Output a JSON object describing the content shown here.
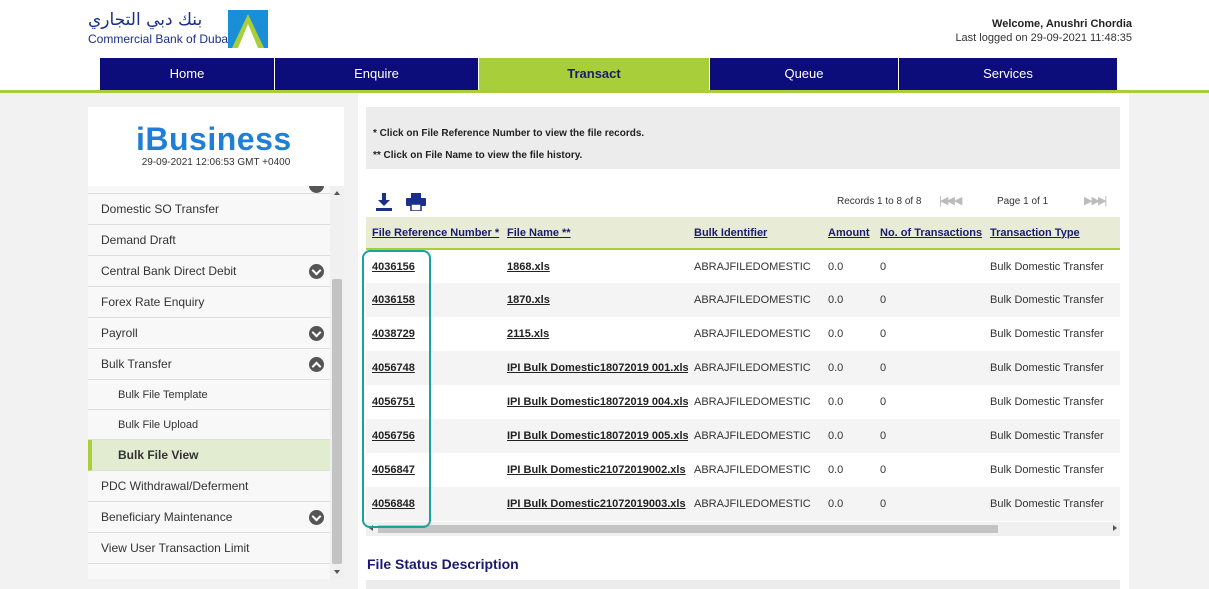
{
  "header": {
    "bank_name_arabic": "بنك دبي التجاري",
    "bank_name_english": "Commercial Bank of Dubai",
    "welcome": "Welcome, Anushri Chordia",
    "last_logged": "Last logged on 29-09-2021 11:48:35",
    "brand_color": "#1a2f8a"
  },
  "nav": {
    "items": [
      {
        "label": "Home",
        "active": false
      },
      {
        "label": "Enquire",
        "active": false
      },
      {
        "label": "Transact",
        "active": true
      },
      {
        "label": "Queue",
        "active": false
      },
      {
        "label": "Services",
        "active": false
      }
    ],
    "accent_color": "#a8cf3a",
    "nav_color": "#0c0c7a"
  },
  "sidebar": {
    "brand": "iBusiness",
    "timestamp": "29-09-2021 12:06:53 GMT +0400",
    "items": [
      {
        "label": "Domestic SO Transfer",
        "expander": ""
      },
      {
        "label": "Demand Draft",
        "expander": ""
      },
      {
        "label": "Central Bank Direct Debit",
        "expander": "down"
      },
      {
        "label": "Forex Rate Enquiry",
        "expander": ""
      },
      {
        "label": "Payroll",
        "expander": "down"
      },
      {
        "label": "Bulk Transfer",
        "expander": "up"
      },
      {
        "label": "Bulk File Template",
        "sub": true
      },
      {
        "label": "Bulk File Upload",
        "sub": true
      },
      {
        "label": "Bulk File View",
        "sub": true,
        "selected": true
      },
      {
        "label": "PDC Withdrawal/Deferment",
        "expander": ""
      },
      {
        "label": "Beneficiary Maintenance",
        "expander": "down"
      },
      {
        "label": "View User Transaction Limit",
        "expander": ""
      }
    ]
  },
  "notes": {
    "line1": "* Click on File Reference Number to view the file records.",
    "line2": "** Click on File Name to view the file history."
  },
  "toolbar": {
    "download_icon": "download-icon",
    "print_icon": "print-icon",
    "records": "Records 1 to 8 of 8",
    "page": "Page 1 of 1"
  },
  "table": {
    "columns": [
      "File Reference Number *",
      "File Name **",
      "Bulk Identifier",
      "Amount",
      "No. of Transactions",
      "Transaction Type"
    ],
    "rows": [
      [
        "4036156",
        "1868.xls",
        "ABRAJFILEDOMESTIC",
        "0.0",
        "0",
        "Bulk Domestic Transfer"
      ],
      [
        "4036158",
        "1870.xls",
        "ABRAJFILEDOMESTIC",
        "0.0",
        "0",
        "Bulk Domestic Transfer"
      ],
      [
        "4038729",
        "2115.xls",
        "ABRAJFILEDOMESTIC",
        "0.0",
        "0",
        "Bulk Domestic Transfer"
      ],
      [
        "4056748",
        "IPI Bulk Domestic18072019 001.xls",
        "ABRAJFILEDOMESTIC",
        "0.0",
        "0",
        "Bulk Domestic Transfer"
      ],
      [
        "4056751",
        "IPI Bulk Domestic18072019 004.xls",
        "ABRAJFILEDOMESTIC",
        "0.0",
        "0",
        "Bulk Domestic Transfer"
      ],
      [
        "4056756",
        "IPI Bulk Domestic18072019 005.xls",
        "ABRAJFILEDOMESTIC",
        "0.0",
        "0",
        "Bulk Domestic Transfer"
      ],
      [
        "4056847",
        "IPI Bulk Domestic21072019002.xls",
        "ABRAJFILEDOMESTIC",
        "0.0",
        "0",
        "Bulk Domestic Transfer"
      ],
      [
        "4056848",
        "IPI Bulk Domestic21072019003.xls",
        "ABRAJFILEDOMESTIC",
        "0.0",
        "0",
        "Bulk Domestic Transfer"
      ]
    ],
    "highlight_color": "#1aa39a"
  },
  "file_status": {
    "title": "File Status Description"
  }
}
